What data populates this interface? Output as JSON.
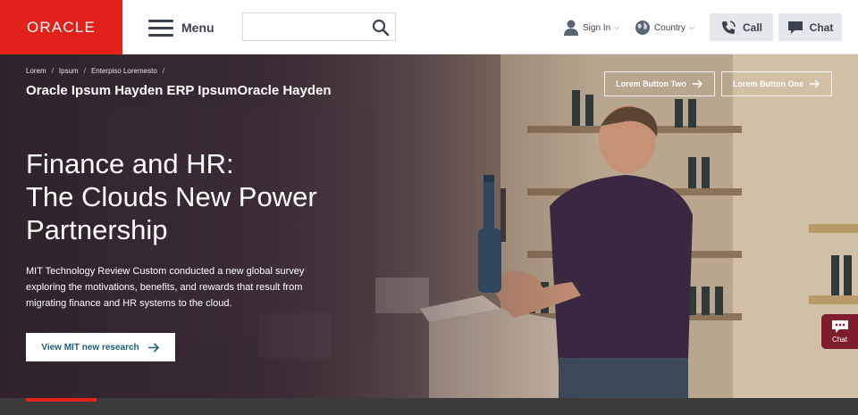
{
  "header": {
    "logo_text": "ORACLE",
    "logo_color": "#e3211b",
    "menu_label": "Menu",
    "search_placeholder": "",
    "sign_in_label": "Sign In",
    "country_label": "Country",
    "call_label": "Call",
    "chat_label": "Chat"
  },
  "hero": {
    "breadcrumbs": [
      "Lorem",
      "Ipsum",
      "Enterpiso Loremesto"
    ],
    "breadcrumb_separator": "/",
    "page_title": "Oracle Ipsum Hayden ERP IpsumOracle Hayden",
    "button_two": "Lorem Button Two",
    "button_one": "Lorem Button One",
    "headline_lines": [
      "Finance and HR:",
      "The Clouds New Power",
      "Partnership"
    ],
    "description_lines": [
      "MIT Technology Review Custom conducted a new global survey",
      "exploring the motivations, benefits, and rewards that result from",
      "migrating finance and HR systems to the cloud."
    ],
    "cta_label": "View MIT new research",
    "cta_color": "#1d5e73",
    "slide_progress": 0.25
  },
  "chat_tab": {
    "label": "Chat",
    "color": "#7f1d2d"
  },
  "icons": {
    "search": "search-icon",
    "user": "user-icon",
    "globe": "globe-icon",
    "phone": "phone-icon",
    "chat": "chat-bubble-icon",
    "arrow": "arrow-right-icon"
  }
}
